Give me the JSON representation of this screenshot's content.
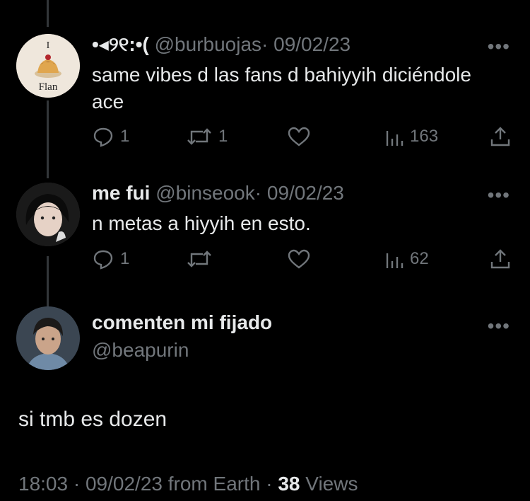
{
  "tweets": [
    {
      "display_name": "•◂︎୨୧:•(",
      "handle": "@burbuojas",
      "date": "· 09/02/23",
      "text": "same vibes d las fans d bahiyyih diciéndole ace",
      "avatar_caption_top": "I",
      "avatar_caption_bottom": "Flan",
      "replies": "1",
      "reposts": "1",
      "likes": "",
      "views": "163"
    },
    {
      "display_name": "me fui",
      "handle": "@binseook",
      "date": "· 09/02/23",
      "text": "n metas a hiyyih en esto.",
      "replies": "1",
      "reposts": "",
      "likes": "",
      "views": "62"
    }
  ],
  "focus_tweet": {
    "display_name": "comenten mi fijado",
    "handle": "@beapurin",
    "text": "si tmb es dozen",
    "time": "18:03",
    "date": "09/02/23",
    "source": "from Earth",
    "views_count": "38",
    "views_label": "Views"
  },
  "more_label": "•••",
  "icons": [
    "reply-icon",
    "repost-icon",
    "like-icon",
    "views-icon",
    "share-icon",
    "more-icon"
  ],
  "colors": {
    "background": "#000000",
    "text": "#e7e9ea",
    "muted": "#71767b"
  }
}
